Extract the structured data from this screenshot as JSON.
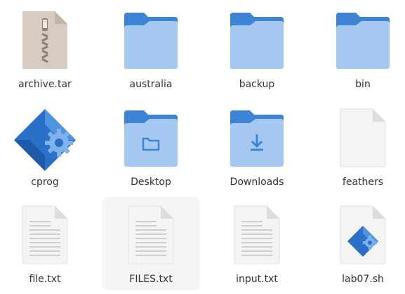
{
  "items": [
    {
      "label": "archive.tar",
      "icon": "archive-icon"
    },
    {
      "label": "australia",
      "icon": "folder-icon"
    },
    {
      "label": "backup",
      "icon": "folder-icon"
    },
    {
      "label": "bin",
      "icon": "folder-icon"
    },
    {
      "label": "cprog",
      "icon": "application-icon"
    },
    {
      "label": "Desktop",
      "icon": "desktop-folder-icon"
    },
    {
      "label": "Downloads",
      "icon": "downloads-folder-icon"
    },
    {
      "label": "feathers",
      "icon": "blank-file-icon"
    },
    {
      "label": "file.txt",
      "icon": "text-file-icon"
    },
    {
      "label": "FILES.txt",
      "icon": "text-file-icon",
      "selected": true
    },
    {
      "label": "input.txt",
      "icon": "text-file-icon"
    },
    {
      "label": "lab07.sh",
      "icon": "script-file-icon"
    }
  ],
  "colors": {
    "folder_back": "#3d84d6",
    "folder_front": "#a4c8ef",
    "folder_glyph": "#3d84d6",
    "file_page": "#f4f4f4",
    "file_fold": "#dddddd",
    "archive_page": "#d6ccc1",
    "text": "#2e3436"
  }
}
